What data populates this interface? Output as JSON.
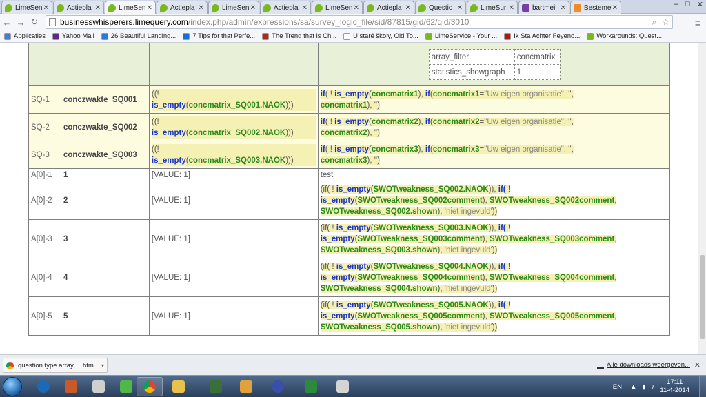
{
  "tabs": [
    {
      "label": "LimeSen",
      "icon": "lime",
      "active": false
    },
    {
      "label": "Actiepla",
      "icon": "lime",
      "active": false
    },
    {
      "label": "LimeSen",
      "icon": "lime",
      "active": true
    },
    {
      "label": "Actiepla",
      "icon": "lime",
      "active": false
    },
    {
      "label": "LimeSen",
      "icon": "lime",
      "active": false
    },
    {
      "label": "Actiepla",
      "icon": "lime",
      "active": false
    },
    {
      "label": "LimeSen",
      "icon": "lime",
      "active": false
    },
    {
      "label": "Actiepla",
      "icon": "lime",
      "active": false
    },
    {
      "label": "Questio",
      "icon": "lime",
      "active": false
    },
    {
      "label": "LimeSur",
      "icon": "lime",
      "active": false
    },
    {
      "label": "bartmeil",
      "icon": "mail",
      "active": false
    },
    {
      "label": "Besteme",
      "icon": "orange",
      "active": false
    }
  ],
  "address": {
    "host": "businesswhisperers.limequery.com",
    "path": "/index.php/admin/expressions/sa/survey_logic_file/sid/87815/gid/62/qid/3010"
  },
  "bookmarks": [
    {
      "label": "Applicaties",
      "color": "#4a79d8"
    },
    {
      "label": "Yahoo Mail",
      "color": "#5b2a86"
    },
    {
      "label": "26 Beautiful Landing...",
      "color": "#2f7ad4"
    },
    {
      "label": "7 Tips for that Perfe...",
      "color": "#1c6dd0"
    },
    {
      "label": "The Trend that is Ch...",
      "color": "#c0201a"
    },
    {
      "label": "U staré školy, Old To...",
      "color": "#ffffff"
    },
    {
      "label": "LimeService - Your ...",
      "color": "#7bb81f"
    },
    {
      "label": "Ik Sta Achter Feyeno...",
      "color": "#b31515"
    },
    {
      "label": "Workarounds: Quest...",
      "color": "#7bb81f"
    }
  ],
  "attributes": [
    {
      "key": "array_filter",
      "value": "concmatrix"
    },
    {
      "key": "statistics_showgraph",
      "value": "1"
    }
  ],
  "sq_rows": [
    {
      "code": "SQ-1",
      "name": "conczwakte_SQ001",
      "rel_a": "((!",
      "rel_fn": "is_empty",
      "rel_var": "concmatrix_SQ001.NAOK",
      "rel_close": ")))",
      "e_if": "if",
      "e_fn": "is_empty",
      "e_var": "concmatrix1",
      "e_if2": "if",
      "e_var2": "concmatrix1",
      "e_str": "\"Uw eigen organisatie\"",
      "e_comma": ", '',",
      "e_var3": "concmatrix1",
      "e_tail": "), '')"
    },
    {
      "code": "SQ-2",
      "name": "conczwakte_SQ002",
      "rel_a": "((!",
      "rel_fn": "is_empty",
      "rel_var": "concmatrix_SQ002.NAOK",
      "rel_close": ")))",
      "e_if": "if",
      "e_fn": "is_empty",
      "e_var": "concmatrix2",
      "e_if2": "if",
      "e_var2": "concmatrix2",
      "e_str": "\"Uw eigen organisatie\"",
      "e_comma": ", '',",
      "e_var3": "concmatrix2",
      "e_tail": "), '')"
    },
    {
      "code": "SQ-3",
      "name": "conczwakte_SQ003",
      "rel_a": "((!",
      "rel_fn": "is_empty",
      "rel_var": "concmatrix_SQ003.NAOK",
      "rel_close": ")))",
      "e_if": "if",
      "e_fn": "is_empty",
      "e_var": "concmatrix3",
      "e_if2": "if",
      "e_var2": "concmatrix3",
      "e_str": "\"Uw eigen organisatie\"",
      "e_comma": ", '',",
      "e_var3": "concmatrix3",
      "e_tail": "), '')"
    }
  ],
  "a0_first": {
    "code": "A[0]-1",
    "name": "1",
    "value": "[VALUE: 1]",
    "expr": "test"
  },
  "a0_rows": [
    {
      "code": "A[0]-2",
      "name": "2",
      "value": "[VALUE: 1]",
      "v1": "SWOTweakness_SQ002.NAOK",
      "v2": "SWOTweakness_SQ002comment",
      "v3": "SWOTweakness_SQ002comment",
      "v4": "SWOTweakness_SQ002.shown",
      "str": "'niet ingevuld'"
    },
    {
      "code": "A[0]-3",
      "name": "3",
      "value": "[VALUE: 1]",
      "v1": "SWOTweakness_SQ003.NAOK",
      "v2": "SWOTweakness_SQ003comment",
      "v3": "SWOTweakness_SQ003comment",
      "v4": "SWOTweakness_SQ003.shown",
      "str": "'niet ingevuld'"
    },
    {
      "code": "A[0]-4",
      "name": "4",
      "value": "[VALUE: 1]",
      "v1": "SWOTweakness_SQ004.NAOK",
      "v2": "SWOTweakness_SQ004comment",
      "v3": "SWOTweakness_SQ004comment",
      "v4": "SWOTweakness_SQ004.shown",
      "str": "'niet ingevuld'"
    },
    {
      "code": "A[0]-5",
      "name": "5",
      "value": "[VALUE: 1]",
      "v1": "SWOTweakness_SQ005.NAOK",
      "v2": "SWOTweakness_SQ005comment",
      "v3": "SWOTweakness_SQ005comment",
      "v4": "SWOTweakness_SQ005.shown",
      "str": "'niet ingevuld'"
    }
  ],
  "expr_tokens": {
    "open_if": "(if(",
    "bang": "!",
    "fn": "is_empty",
    "if2": "if(",
    "close": ")),",
    "comma": ",",
    "tail": "))"
  },
  "download": {
    "file": "question type array ....htm",
    "show_all": "Alle downloads weergeven..."
  },
  "taskbar": {
    "lang": "EN",
    "time": "17:11",
    "date": "11-4-2014"
  }
}
